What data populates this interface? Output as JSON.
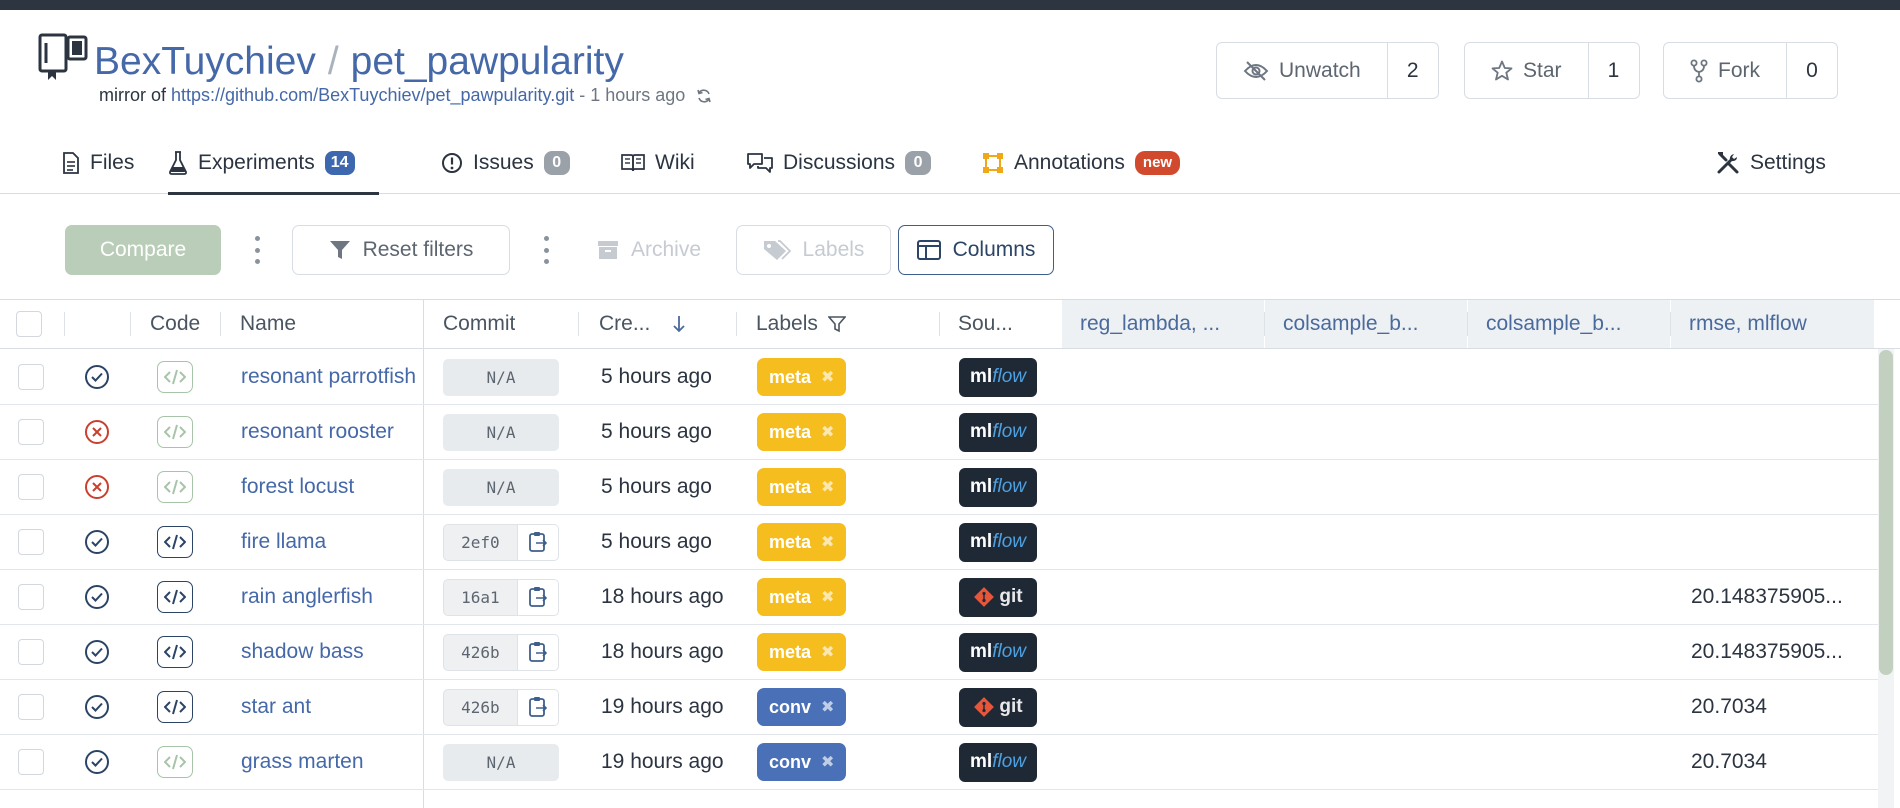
{
  "repo": {
    "owner": "BexTuychiev",
    "separator": "/",
    "name": "pet_pawpularity",
    "mirror_prefix": "mirror of",
    "mirror_url": "https://github.com/BexTuychiev/pet_pawpularity.git",
    "mirror_time": "- 1 hours ago"
  },
  "actions": {
    "watch": {
      "label": "Unwatch",
      "count": "2"
    },
    "star": {
      "label": "Star",
      "count": "1"
    },
    "fork": {
      "label": "Fork",
      "count": "0"
    }
  },
  "tabs": {
    "files": "Files",
    "experiments": {
      "label": "Experiments",
      "count": "14"
    },
    "issues": {
      "label": "Issues",
      "count": "0"
    },
    "wiki": "Wiki",
    "discussions": {
      "label": "Discussions",
      "count": "0"
    },
    "annotations": {
      "label": "Annotations",
      "badge": "new"
    },
    "settings": "Settings"
  },
  "toolbar": {
    "compare": "Compare",
    "reset_filters": "Reset filters",
    "archive": "Archive",
    "labels": "Labels",
    "columns": "Columns"
  },
  "table": {
    "headers": {
      "code": "Code",
      "name": "Name",
      "commit": "Commit",
      "created": "Cre...",
      "labels": "Labels",
      "source": "Sou...",
      "col1": "reg_lambda, ...",
      "col2": "colsample_b...",
      "col3": "colsample_b...",
      "col4": "rmse, mlflow"
    },
    "rows": [
      {
        "status": "success",
        "code_available": false,
        "name": "resonant parrotfish",
        "commit": "N/A",
        "created": "5 hours ago",
        "label": "meta",
        "source": "mlflow",
        "rmse": ""
      },
      {
        "status": "failed",
        "code_available": false,
        "name": "resonant rooster",
        "commit": "N/A",
        "created": "5 hours ago",
        "label": "meta",
        "source": "mlflow",
        "rmse": ""
      },
      {
        "status": "failed",
        "code_available": false,
        "name": "forest locust",
        "commit": "N/A",
        "created": "5 hours ago",
        "label": "meta",
        "source": "mlflow",
        "rmse": ""
      },
      {
        "status": "success",
        "code_available": true,
        "name": "fire llama",
        "commit": "2ef0",
        "created": "5 hours ago",
        "label": "meta",
        "source": "mlflow",
        "rmse": ""
      },
      {
        "status": "success",
        "code_available": true,
        "name": "rain anglerfish",
        "commit": "16a1",
        "created": "18 hours ago",
        "label": "meta",
        "source": "git",
        "rmse": "20.148375905..."
      },
      {
        "status": "success",
        "code_available": true,
        "name": "shadow bass",
        "commit": "426b",
        "created": "18 hours ago",
        "label": "meta",
        "source": "mlflow",
        "rmse": "20.148375905..."
      },
      {
        "status": "success",
        "code_available": true,
        "name": "star ant",
        "commit": "426b",
        "created": "19 hours ago",
        "label": "conv",
        "source": "git",
        "rmse": "20.7034"
      },
      {
        "status": "success",
        "code_available": false,
        "name": "grass marten",
        "commit": "N/A",
        "created": "19 hours ago",
        "label": "conv",
        "source": "mlflow",
        "rmse": "20.7034"
      }
    ]
  },
  "source_text": {
    "ml": "ml",
    "flow": "flow",
    "git": "git"
  },
  "colors": {
    "accent": "#4568a8",
    "success": "#2b4466",
    "failed": "#c8402f",
    "meta_label": "#f5bd1d",
    "conv_label": "#4a70b8"
  }
}
